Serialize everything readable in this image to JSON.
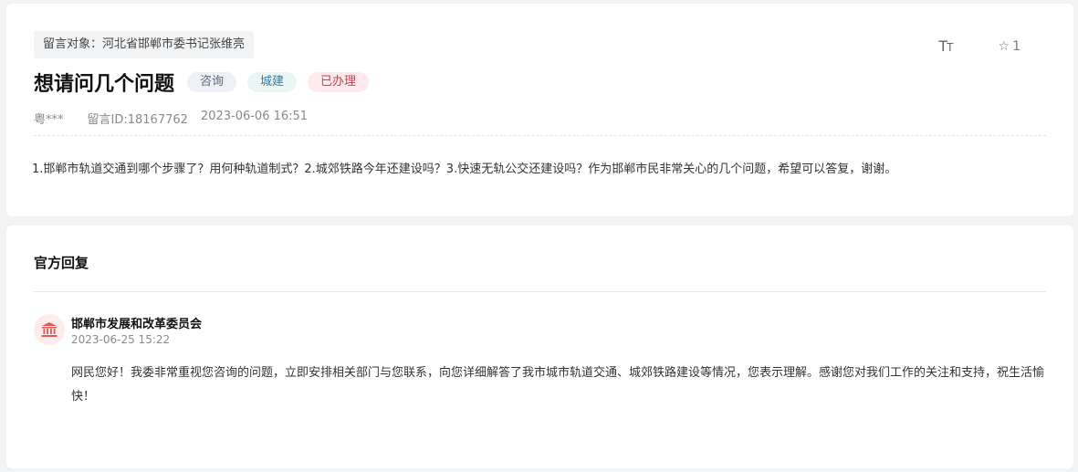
{
  "message": {
    "target_label": "留言对象：河北省邯郸市委书记张维亮",
    "font_size_icon": "font-size-icon",
    "favorite": {
      "icon": "star-outline-icon",
      "count": "1"
    },
    "title": "想请问几个问题",
    "tags": [
      {
        "label": "咨询",
        "color": "#5a6a7c"
      },
      {
        "label": "城建",
        "color": "#3a7a9c"
      },
      {
        "label": "已办理",
        "color": "#d23b48"
      }
    ],
    "author": "粤***",
    "message_id": "留言ID:18167762",
    "datetime": "2023-06-06 16:51",
    "content": "1.邯郸市轨道交通到哪个步骤了？用何种轨道制式？2.城郊铁路今年还建设吗？3.快速无轨公交还建设吗？作为邯郸市民非常关心的几个问题，希望可以答复，谢谢。"
  },
  "reply": {
    "heading": "官方回复",
    "avatar_icon": "government-building-icon",
    "organization": "邯郸市发展和改革委员会",
    "date": "2023-06-25 15:22",
    "text": "网民您好！我委非常重视您咨询的问题，立即安排相关部门与您联系，向您详细解答了我市城市轨道交通、城郊铁路建设等情况，您表示理解。感谢您对我们工作的关注和支持，祝生活愉快！"
  }
}
